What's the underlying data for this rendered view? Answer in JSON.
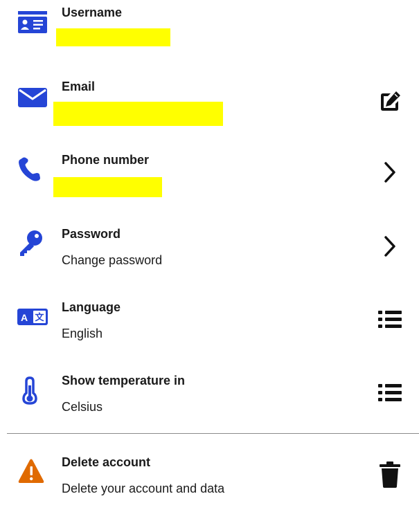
{
  "colors": {
    "accent": "#2545d6",
    "warning": "#e06a00",
    "redaction": "#ffff00"
  },
  "account": {
    "username": {
      "title": "Username",
      "icon": "id-card-icon"
    },
    "email": {
      "title": "Email",
      "icon": "envelope-icon",
      "action_icon": "edit-icon"
    },
    "phone": {
      "title": "Phone number",
      "icon": "phone-icon",
      "action_icon": "chevron-right-icon"
    },
    "password": {
      "title": "Password",
      "subtitle": "Change password",
      "icon": "key-icon",
      "action_icon": "chevron-right-icon"
    },
    "language": {
      "title": "Language",
      "subtitle": "English",
      "icon": "translate-icon",
      "action_icon": "list-icon"
    },
    "temperature": {
      "title": "Show temperature in",
      "subtitle": "Celsius",
      "icon": "thermometer-icon",
      "action_icon": "list-icon"
    },
    "delete": {
      "title": "Delete account",
      "subtitle": "Delete your account and data",
      "icon": "warning-icon",
      "action_icon": "trash-icon"
    }
  }
}
